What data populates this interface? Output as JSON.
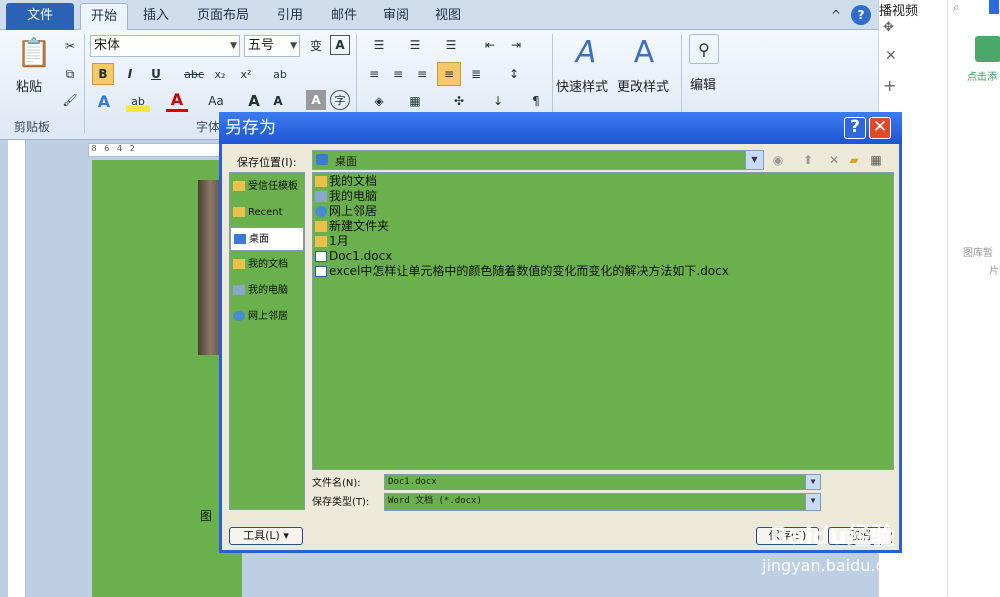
{
  "ribbon_tabs": [
    "文件",
    "开始",
    "插入",
    "页面布局",
    "引用",
    "邮件",
    "审阅",
    "视图"
  ],
  "ribbon": {
    "paste_label": "粘贴",
    "font_name": "宋体",
    "font_size": "五号",
    "clipboard_group": "剪贴板",
    "font_group": "字体",
    "quick_styles": "快速样式",
    "change_styles": "更改样式",
    "edit": "编辑"
  },
  "right_pane": {
    "top_text": "播视频",
    "link_text": "点击添",
    "mid_text": "图库暂",
    "mid_text2": "片"
  },
  "doc": {
    "partial_text": "图"
  },
  "dialog": {
    "title": "另存为",
    "save_in_label": "保存位置(I):",
    "save_in_value": "桌面",
    "places": [
      "受信任模板",
      "Recent",
      "桌面",
      "我的文档",
      "我的电脑",
      "网上邻居"
    ],
    "files": [
      "我的文档",
      "我的电脑",
      "网上邻居",
      "新建文件夹",
      "1月",
      "Doc1.docx",
      "excel中怎样让单元格中的颜色随着数值的变化而变化的解决方法如下.docx"
    ],
    "filename_label": "文件名(N):",
    "filename_value": "Doc1.docx",
    "filetype_label": "保存类型(T):",
    "filetype_value": "Word 文档 (*.docx)",
    "tools_label": "工具(L)",
    "save_label": "保存(S)",
    "cancel_label": "取消"
  },
  "watermark": {
    "line1": "Baidu经验",
    "line2": "jingyan.baidu.com"
  }
}
